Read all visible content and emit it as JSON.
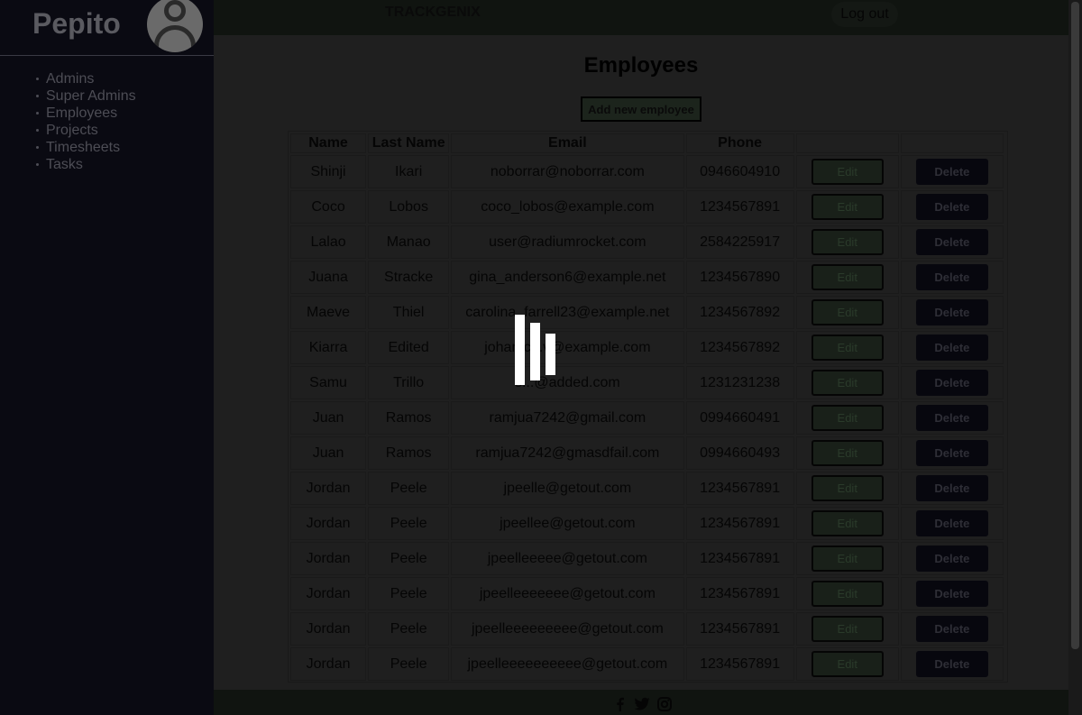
{
  "sidebar": {
    "brand": "Pepito",
    "nav": [
      "Admins",
      "Super Admins",
      "Employees",
      "Projects",
      "Timesheets",
      "Tasks"
    ]
  },
  "header": {
    "title": "TRACKGENIX",
    "logout_label": "Log out"
  },
  "main": {
    "page_title": "Employees",
    "add_button_label": "Add new employee",
    "table": {
      "headers": [
        "Name",
        "Last Name",
        "Email",
        "Phone",
        "",
        ""
      ],
      "edit_label": "Edit",
      "delete_label": "Delete",
      "rows": [
        {
          "name": "Shinji",
          "last_name": "Ikari",
          "email": "noborrar@noborrar.com",
          "phone": "0946604910"
        },
        {
          "name": "Coco",
          "last_name": "Lobos",
          "email": "coco_lobos@example.com",
          "phone": "1234567891"
        },
        {
          "name": "Lalao",
          "last_name": "Manao",
          "email": "user@radiumrocket.com",
          "phone": "2584225917"
        },
        {
          "name": "Juana",
          "last_name": "Stracke",
          "email": "gina_anderson6@example.net",
          "phone": "1234567890"
        },
        {
          "name": "Maeve",
          "last_name": "Thiel",
          "email": "carolina_farrell23@example.net",
          "phone": "1234567892"
        },
        {
          "name": "Kiarra",
          "last_name": "Edited",
          "email": "johan.c...v@example.com",
          "phone": "1234567892"
        },
        {
          "name": "Samu",
          "last_name": "Trillo",
          "email": "s...@added.com",
          "phone": "1231231238"
        },
        {
          "name": "Juan",
          "last_name": "Ramos",
          "email": "ramjua7242@gmail.com",
          "phone": "0994660491"
        },
        {
          "name": "Juan",
          "last_name": "Ramos",
          "email": "ramjua7242@gmasdfail.com",
          "phone": "0994660493"
        },
        {
          "name": "Jordan",
          "last_name": "Peele",
          "email": "jpeelle@getout.com",
          "phone": "1234567891"
        },
        {
          "name": "Jordan",
          "last_name": "Peele",
          "email": "jpeellee@getout.com",
          "phone": "1234567891"
        },
        {
          "name": "Jordan",
          "last_name": "Peele",
          "email": "jpeelleeeee@getout.com",
          "phone": "1234567891"
        },
        {
          "name": "Jordan",
          "last_name": "Peele",
          "email": "jpeelleeeeeee@getout.com",
          "phone": "1234567891"
        },
        {
          "name": "Jordan",
          "last_name": "Peele",
          "email": "jpeelleeeeeeeee@getout.com",
          "phone": "1234567891"
        },
        {
          "name": "Jordan",
          "last_name": "Peele",
          "email": "jpeelleeeeeeeeee@getout.com",
          "phone": "1234567891"
        }
      ]
    }
  },
  "footer": {
    "icons": [
      "facebook-icon",
      "twitter-icon",
      "instagram-icon"
    ]
  },
  "loader": {
    "icon": "loading-spinner-icon"
  }
}
